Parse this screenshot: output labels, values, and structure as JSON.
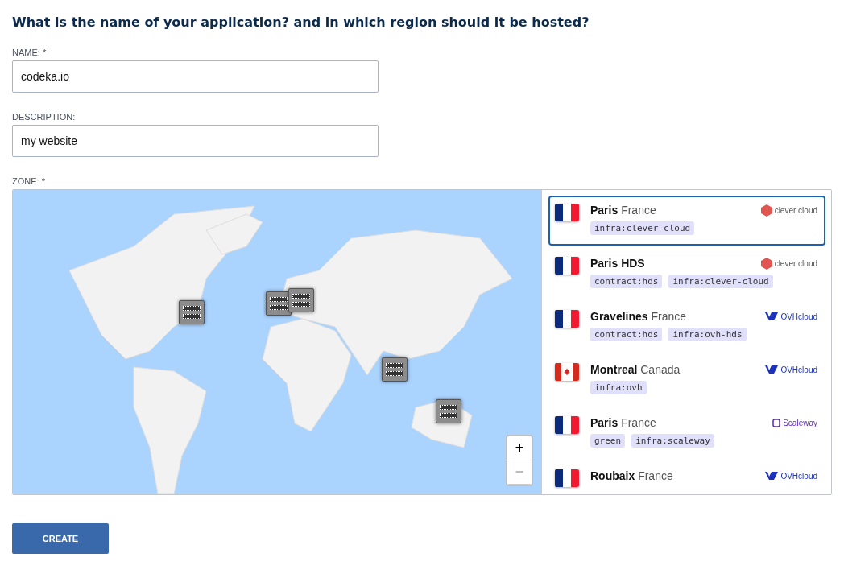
{
  "heading": "What is the name of your application? and in which region should it be hosted?",
  "fields": [
    {
      "label": "NAME: *",
      "value": "codeka.io"
    },
    {
      "label": "DESCRIPTION:",
      "value": "my website"
    }
  ],
  "zone": {
    "label": "ZONE: *",
    "map": {
      "zoom_in": "+",
      "zoom_out": "−",
      "zoom_out_disabled": true
    },
    "zones": [
      {
        "flag": {
          "kind": "fr"
        },
        "city": "Paris",
        "country": "France",
        "provider": {
          "kind": "clever",
          "label": "clever cloud"
        },
        "tags": [
          "infra:clever-cloud"
        ],
        "selected": true
      },
      {
        "flag": {
          "kind": "fr"
        },
        "city": "Paris HDS",
        "provider": {
          "kind": "clever",
          "label": "clever cloud"
        },
        "tags": [
          "contract:hds",
          "infra:clever-cloud"
        ],
        "selected": false
      },
      {
        "flag": {
          "kind": "fr"
        },
        "city": "Gravelines",
        "country": "France",
        "provider": {
          "kind": "ovh",
          "label": "OVHcloud"
        },
        "tags": [
          "contract:hds",
          "infra:ovh-hds"
        ],
        "selected": false
      },
      {
        "flag": {
          "kind": "ca"
        },
        "city": "Montreal",
        "country": "Canada",
        "provider": {
          "kind": "ovh",
          "label": "OVHcloud"
        },
        "tags": [
          "infra:ovh"
        ],
        "selected": false
      },
      {
        "flag": {
          "kind": "fr"
        },
        "city": "Paris",
        "country": "France",
        "provider": {
          "kind": "scaleway",
          "label": "Scaleway"
        },
        "tags": [
          "green",
          "infra:scaleway"
        ],
        "selected": false
      },
      {
        "flag": {
          "kind": "fr"
        },
        "city": "Roubaix",
        "country": "France",
        "provider": {
          "kind": "ovh",
          "label": "OVHcloud"
        },
        "selected": false
      }
    ]
  },
  "submit": "CREATE"
}
